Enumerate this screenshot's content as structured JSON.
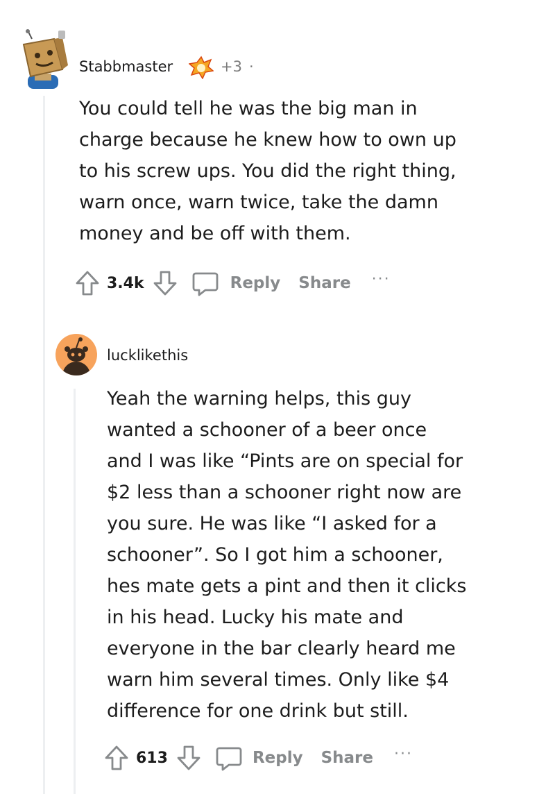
{
  "comments": [
    {
      "username": "Stabbmaster",
      "flair_icon": "award-icon",
      "awards": "+3",
      "separator": "·",
      "body": [
        "You could tell he was the big man in",
        "charge because he knew how to own up",
        "to his screw ups. You did the right thing,",
        "warn once, warn twice, take the damn",
        "money and be off with them."
      ],
      "score": "3.4k",
      "reply_label": "Reply",
      "share_label": "Share",
      "more_label": "···"
    },
    {
      "username": "lucklikethis",
      "body": [
        "Yeah the warning helps, this guy",
        "wanted a schooner of a beer once",
        "and I was like “Pints are on special for",
        "$2 less than a schooner right now are",
        "you sure. He was like “I asked for a",
        "schooner”. So I got him a schooner,",
        "hes mate gets a pint and then it clicks",
        "in his head. Lucky his mate and",
        "everyone in the bar clearly heard me",
        "warn him several times. Only like $4",
        "difference for one drink but still."
      ],
      "score": "613",
      "reply_label": "Reply",
      "share_label": "Share",
      "more_label": "···"
    }
  ],
  "colors": {
    "avatar_orange": "#f7a35c",
    "thread_line": "#edeff1",
    "muted_text": "#878a8c"
  }
}
